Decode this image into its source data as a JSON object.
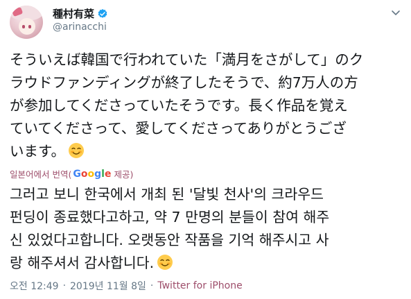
{
  "user": {
    "display_name": "種村有菜",
    "handle": "@arinacchi"
  },
  "tweet": {
    "text": "そういえば韓国で行われていた「満月をさがして」のク\nラウドファンディングが終了したそうで、約7万人の方\nが参加してくださっていたそうです。長く作品を覚え\nていてくださって、愛してくださってありがとうござ\nいます。",
    "emoji": "smiling-face-with-blush"
  },
  "translation": {
    "label": "일본어에서 번역(",
    "provider": "Google",
    "credit": "제공)",
    "text": "그러고 보니 한국에서 개최 된 '달빛 천사'의 크라우드\n펀딩이 종료했다고하고, 약 7 만명의 분들이 참여 해주\n신 있었다고합니다. 오랫동안 작품을 기억 해주시고 사\n랑 해주셔서 감사합니다."
  },
  "meta": {
    "time": "오전 12:49",
    "date": "2019년 11월 8일",
    "separator": "·",
    "source": "Twitter for iPhone"
  },
  "colors": {
    "verified": "#1da1f2",
    "muted": "#657786",
    "link": "#9d4d6a"
  }
}
